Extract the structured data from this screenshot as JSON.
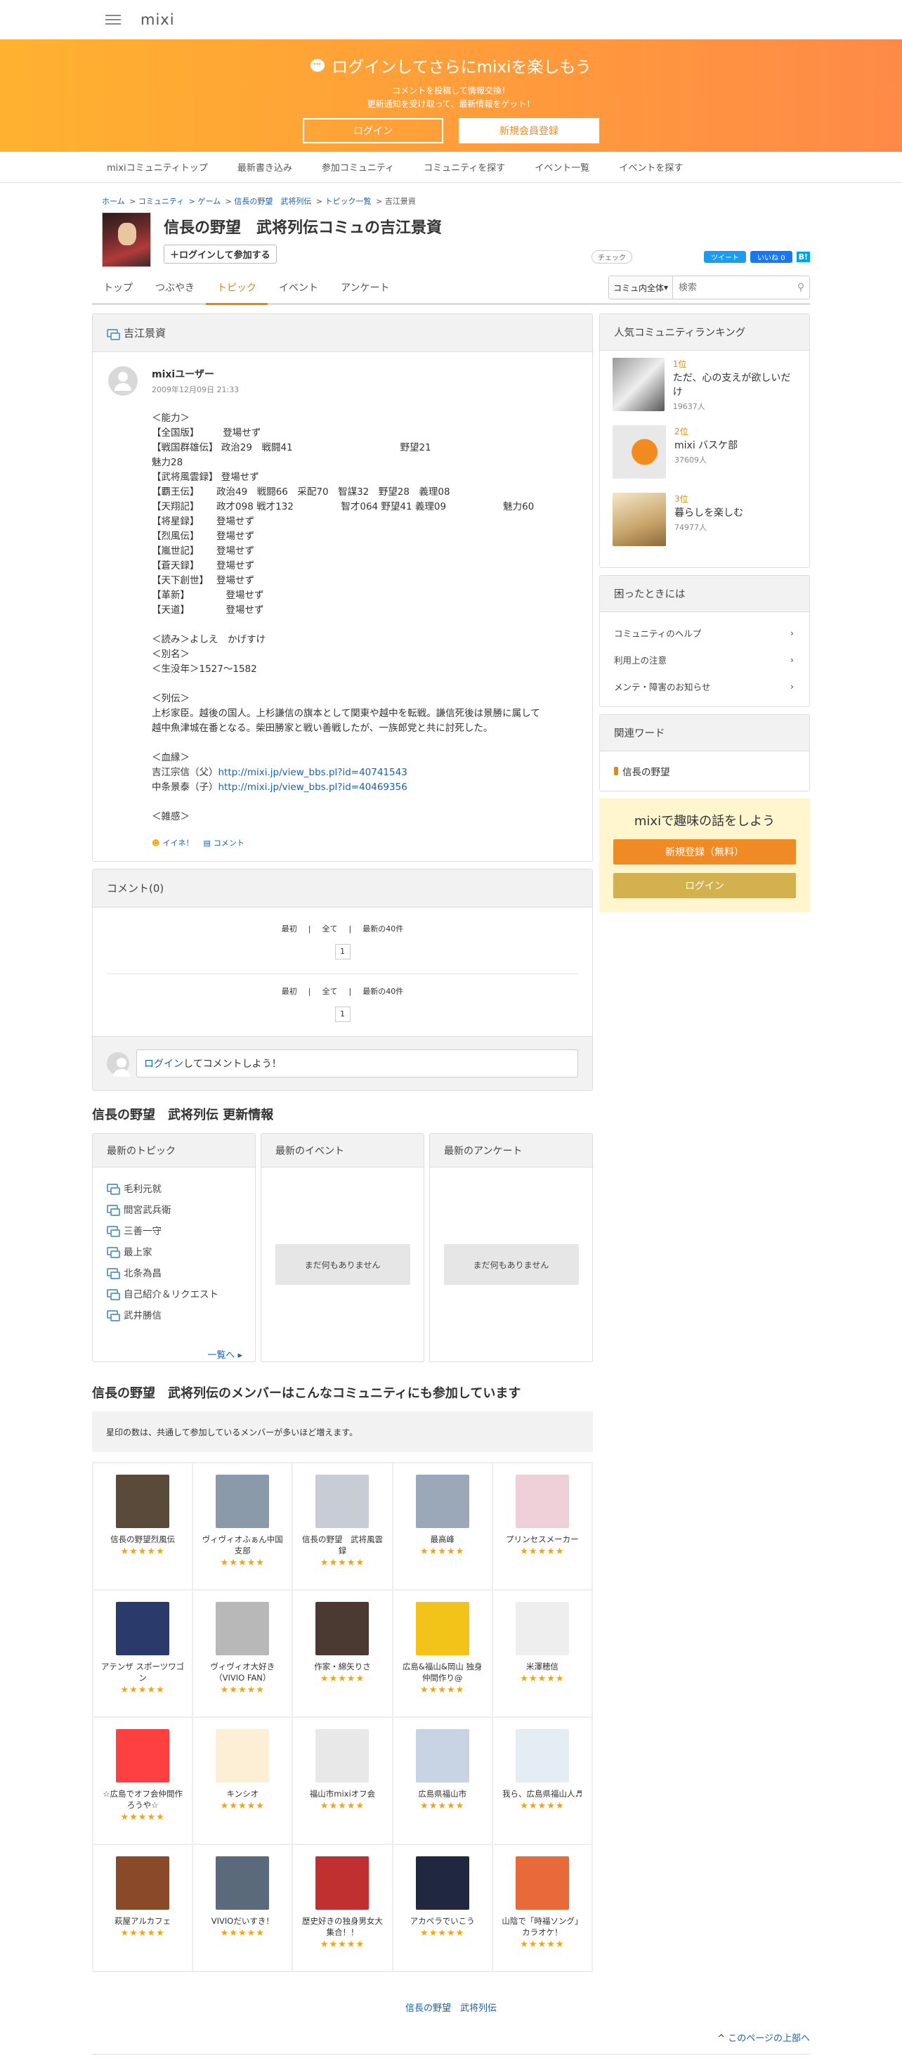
{
  "header": {
    "logo": "mixi"
  },
  "banner": {
    "title": "ログインしてさらにmixiを楽しもう",
    "sub1": "コメントを投稿して情報交換！",
    "sub2": "更新通知を受け取って、最新情報をゲット！",
    "login": "ログイン",
    "register": "新規会員登録"
  },
  "subnav": [
    "mixiコミュニティトップ",
    "最新書き込み",
    "参加コミュニティ",
    "コミュニティを探す",
    "イベント一覧",
    "イベントを探す"
  ],
  "breadcrumb": [
    "ホーム",
    "コミュニティ",
    "ゲーム",
    "信長の野望　武将列伝",
    "トピック一覧",
    "吉江景資"
  ],
  "community": {
    "title": "信長の野望　武将列伝コミュの吉江景資",
    "join": "ログインして参加する"
  },
  "share": {
    "check": "チェック",
    "tweet": "ツイート",
    "like": "いいね 0",
    "hatena": "B!"
  },
  "tabs": [
    "トップ",
    "つぶやき",
    "トピック",
    "イベント",
    "アンケート"
  ],
  "search": {
    "scope": "コミュ内全体",
    "placeholder": "検索"
  },
  "topic": {
    "title": "吉江景資",
    "author": "mixiユーザー",
    "date": "2009年12月09日 21:33",
    "body": "＜能力＞\n【全国版】　　　登場せず\n【戦国群雄伝】 政治29　戦闘41　　　　　　　　　　　 野望21\n魅力28\n【武将風雲録】 登場せず\n【覇王伝】　　 政治49　戦闘66　采配70　智謀32　野望28　義理08\n【天翔記】　　 政才098 戦才132　　　　　智才064 野望41 義理09　　　　　　魅力60\n【将星録】　　 登場せず\n【烈風伝】　　 登場せず\n【嵐世記】　　 登場せず\n【蒼天録】　　 登場せず\n【天下創世】　 登場せず\n【革新】　　　　 登場せず\n【天道】　　　　 登場せず\n\n＜読み＞よしえ　かげすけ\n＜別名＞\n＜生没年＞1527～1582\n\n＜列伝＞\n上杉家臣。越後の国人。上杉謙信の旗本として関東や越中を転戦。謙信死後は景勝に属して\n越中魚津城在番となる。柴田勝家と戦い善戦したが、一族郎党と共に討死した。\n\n＜血縁＞",
    "blood1_label": "吉江宗信（父）",
    "blood1_link": "http://mixi.jp/view_bbs.pl?id=40741543",
    "blood2_label": "中条景泰（子）",
    "blood2_link": "http://mixi.jp/view_bbs.pl?id=40469356",
    "misc": "＜雑感＞",
    "like": "イイネ！",
    "comment": "コメント"
  },
  "comments": {
    "title": "コメント(0)",
    "first": "最初",
    "all": "全て",
    "latest": "最新の40件",
    "page": "1",
    "login": "ログイン",
    "login_suffix": "してコメントしよう！"
  },
  "updates": {
    "title": "信長の野望　武将列伝 更新情報",
    "topics_title": "最新のトピック",
    "events_title": "最新のイベント",
    "surveys_title": "最新のアンケート",
    "topics": [
      "毛利元就",
      "間宮武兵衛",
      "三善一守",
      "最上家",
      "北条為昌",
      "自己紹介＆リクエスト",
      "武井勝信"
    ],
    "more": "一覧へ",
    "nothing": "まだ何もありません"
  },
  "members": {
    "title": "信長の野望　武将列伝のメンバーはこんなコミュニティにも参加しています",
    "note": "星印の数は、共通して参加しているメンバーが多いほど増えます。",
    "items": [
      {
        "name": "信長の野望烈風伝",
        "stars": "★★★★★"
      },
      {
        "name": "ヴィヴィオふぁん中国支部",
        "stars": "★★★★★"
      },
      {
        "name": "信長の野望　武将風雲録",
        "stars": "★★★★★"
      },
      {
        "name": "最高峰",
        "stars": "★★★★★"
      },
      {
        "name": "プリンセスメーカー",
        "stars": "★★★★★"
      },
      {
        "name": "アテンザ スポーツワゴン",
        "stars": "★★★★★"
      },
      {
        "name": "ヴィヴィオ大好き（VIVIO FAN）",
        "stars": "★★★★★"
      },
      {
        "name": "作家・綿矢りさ",
        "stars": "★★★★★"
      },
      {
        "name": "広島&福山&岡山 独身仲間作り@",
        "stars": "★★★★★"
      },
      {
        "name": "米澤穂信",
        "stars": "★★★★★"
      },
      {
        "name": "☆広島でオフ会仲間作ろうや☆",
        "stars": "★★★★★"
      },
      {
        "name": "キンシオ",
        "stars": "★★★★★"
      },
      {
        "name": "福山市mixiオフ会",
        "stars": "★★★★★"
      },
      {
        "name": "広島県福山市",
        "stars": "★★★★★"
      },
      {
        "name": "我ら、広島県福山人♬",
        "stars": "★★★★★"
      },
      {
        "name": "萩屋アルカフェ",
        "stars": "★★★★★"
      },
      {
        "name": "VIVIOだいすき！",
        "stars": "★★★★★"
      },
      {
        "name": "歴史好きの独身男女大集合！！",
        "stars": "★★★★★"
      },
      {
        "name": "アカペラでいこう",
        "stars": "★★★★★"
      },
      {
        "name": "山陰で「時福ソング」カラオケ！",
        "stars": "★★★★★"
      }
    ]
  },
  "sidebar": {
    "ranking_title": "人気コミュニティランキング",
    "ranking": [
      {
        "pos": "1位",
        "name": "ただ、心の支えが欲しいだけ",
        "count": "19637人"
      },
      {
        "pos": "2位",
        "name": "mixi バスケ部",
        "count": "37609人"
      },
      {
        "pos": "3位",
        "name": "暮らしを楽しむ",
        "count": "74977人"
      }
    ],
    "help_title": "困ったときには",
    "help": [
      "コミュニティのヘルプ",
      "利用上の注意",
      "メンテ・障害のお知らせ"
    ],
    "kw_title": "関連ワード",
    "kw": "信長の野望",
    "promo_title": "mixiで趣味の話をしよう",
    "promo_register": "新規登録（無料）",
    "promo_login": "ログイン"
  },
  "footer": {
    "link": "信長の野望　武将列伝",
    "top": "このページの上部へ"
  }
}
